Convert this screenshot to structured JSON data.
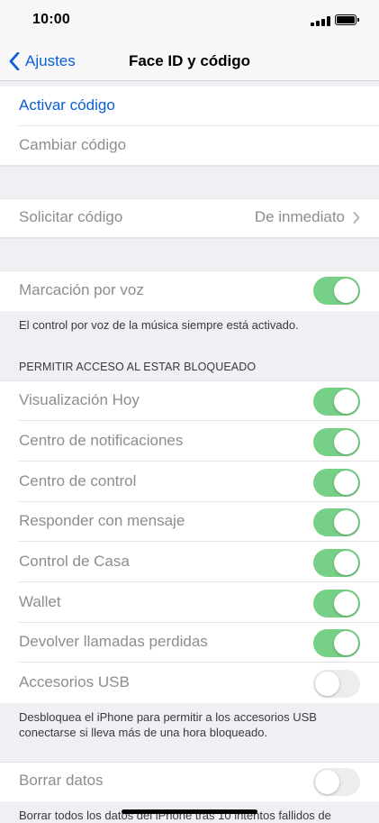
{
  "status_bar": {
    "time": "10:00"
  },
  "nav": {
    "back_label": "Ajustes",
    "title": "Face ID y código"
  },
  "passcode": {
    "activate_label": "Activar código",
    "change_label": "Cambiar código"
  },
  "require": {
    "label": "Solicitar código",
    "value": "De inmediato"
  },
  "voice_dial": {
    "label": "Marcación por voz",
    "on": true,
    "footer": "El control por voz de la música siempre está activado."
  },
  "locked_access": {
    "header": "PERMITIR ACCESO AL ESTAR BLOQUEADO",
    "items": [
      {
        "label": "Visualización Hoy",
        "on": true
      },
      {
        "label": "Centro de notificaciones",
        "on": true
      },
      {
        "label": "Centro de control",
        "on": true
      },
      {
        "label": "Responder con mensaje",
        "on": true
      },
      {
        "label": "Control de Casa",
        "on": true
      },
      {
        "label": "Wallet",
        "on": true
      },
      {
        "label": "Devolver llamadas perdidas",
        "on": true
      },
      {
        "label": "Accesorios USB",
        "on": false
      }
    ],
    "footer": "Desbloquea el iPhone para permitir a los accesorios USB conectarse si lleva más de una hora bloqueado."
  },
  "erase": {
    "label": "Borrar datos",
    "on": false,
    "footer": "Borrar todos los datos del iPhone tras 10 intentos fallidos de"
  },
  "colors": {
    "accent": "#0a5fd6",
    "toggle_on": "#76d085",
    "toggle_off": "#ededef",
    "background": "#efeff4"
  }
}
